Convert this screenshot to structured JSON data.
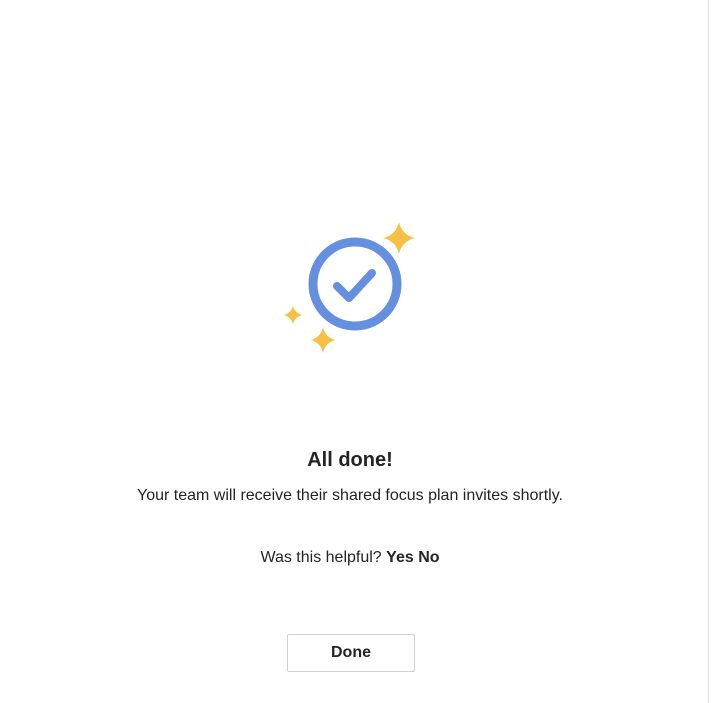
{
  "success": {
    "title": "All done!",
    "message": "Your team will receive their shared focus plan invites shortly."
  },
  "feedback": {
    "question": "Was this helpful?",
    "yes_label": "Yes",
    "no_label": "No"
  },
  "actions": {
    "done_label": "Done"
  },
  "icons": {
    "main": "check-circle-icon",
    "decoration": "sparkle-icon"
  },
  "colors": {
    "accent_blue": "#6590e0",
    "sparkle_yellow": "#f7bf43",
    "text": "#242424",
    "button_border": "#d1d1d1"
  }
}
